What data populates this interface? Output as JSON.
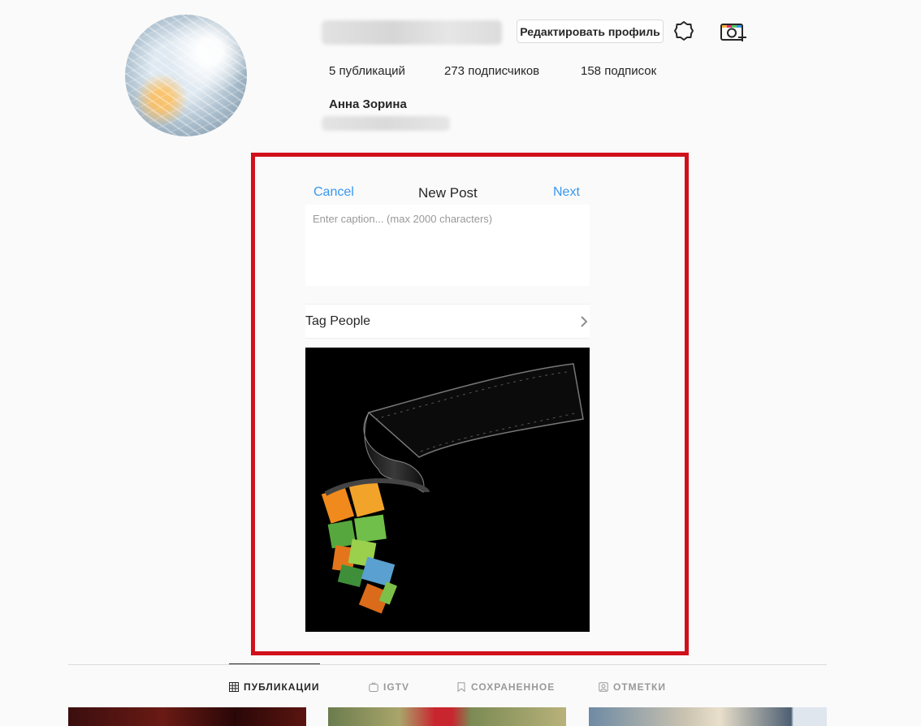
{
  "profile": {
    "edit_button": "Редактировать профиль",
    "stats": {
      "posts": "5 публикаций",
      "followers": "273 подписчиков",
      "following": "158 подписок"
    },
    "full_name": "Анна Зорина"
  },
  "new_post": {
    "cancel": "Cancel",
    "title": "New Post",
    "next": "Next",
    "caption_placeholder": "Enter caption... (max 2000 characters)",
    "tag_people": "Tag People"
  },
  "tabs": [
    {
      "label": "ПУБЛИКАЦИИ",
      "icon": "grid-icon",
      "active": true
    },
    {
      "label": "IGTV",
      "icon": "igtv-icon",
      "active": false
    },
    {
      "label": "СОХРАНЕННОЕ",
      "icon": "bookmark-icon",
      "active": false
    },
    {
      "label": "ОТМЕТКИ",
      "icon": "tagged-icon",
      "active": false
    }
  ],
  "colors": {
    "accent_link": "#3897f0",
    "highlight_frame": "#d0101a"
  }
}
